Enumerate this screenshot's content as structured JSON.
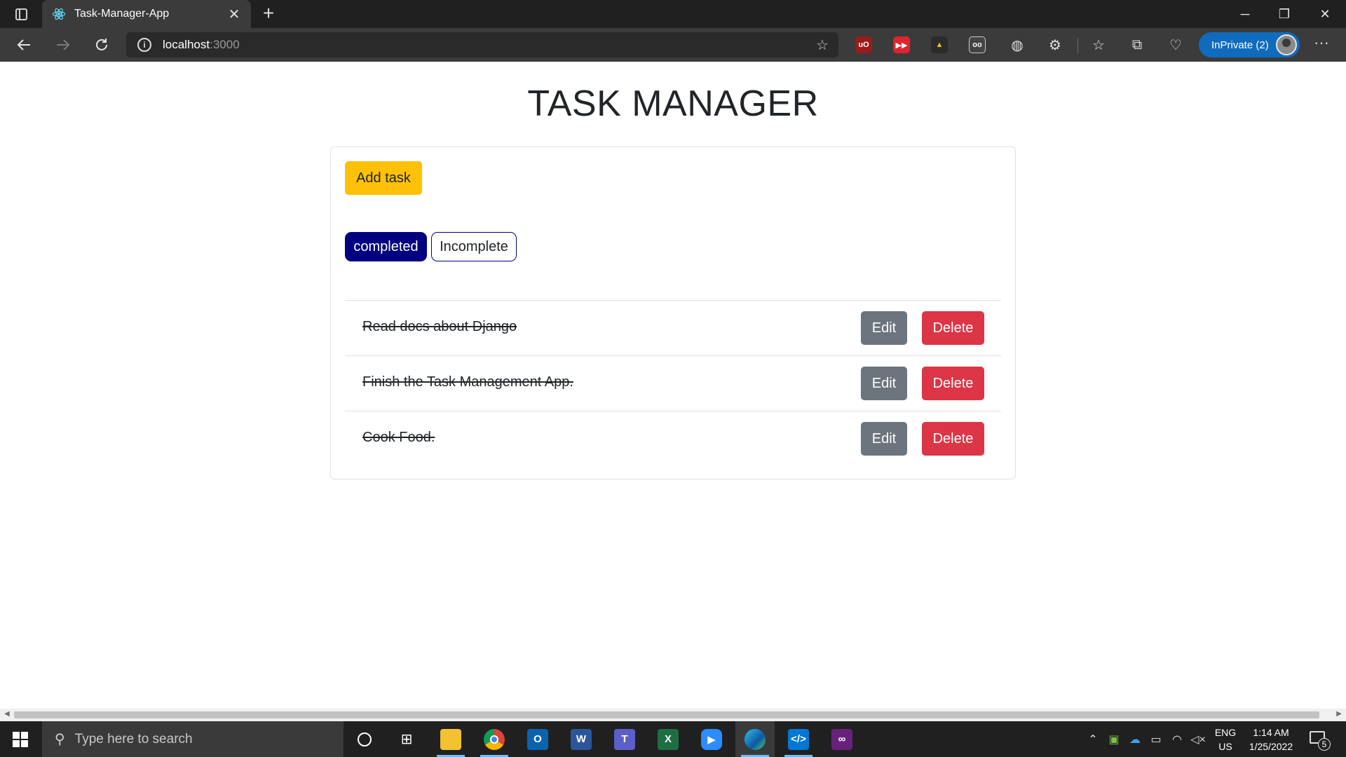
{
  "browser": {
    "tab_title": "Task-Manager-App",
    "tab_close": "✕",
    "new_tab": "+",
    "url_host": "localhost",
    "url_port": ":3000",
    "inprivate_label": "InPrivate (2)",
    "window_controls": {
      "minimize": "─",
      "restore": "❐",
      "close": "✕"
    }
  },
  "page": {
    "title": "TASK MANAGER",
    "add_task_label": "Add task",
    "filters": {
      "completed": "completed",
      "incomplete": "Incomplete"
    },
    "filter_active": "completed",
    "tasks": [
      {
        "text": "Read docs about Django",
        "completed": true,
        "edit_label": "Edit",
        "delete_label": "Delete"
      },
      {
        "text": "Finish the Task Management App.",
        "completed": true,
        "edit_label": "Edit",
        "delete_label": "Delete"
      },
      {
        "text": "Cook Food.",
        "completed": true,
        "edit_label": "Edit",
        "delete_label": "Delete"
      }
    ]
  },
  "taskbar": {
    "search_placeholder": "Type here to search",
    "lang_line1": "ENG",
    "lang_line2": "US",
    "time": "1:14 AM",
    "date": "1/25/2022",
    "notification_count": "5",
    "apps": [
      "cortana-icon",
      "task-view-icon",
      "file-explorer-icon",
      "chrome-icon",
      "outlook-icon",
      "word-icon",
      "teams-icon",
      "excel-icon",
      "zoom-icon",
      "edge-icon",
      "vscode-icon",
      "visual-studio-icon"
    ]
  },
  "colors": {
    "add_task": "#ffc107",
    "completed_filter": "#000080",
    "edit": "#6c757d",
    "delete": "#dc3545",
    "inprivate": "#0f6cbd"
  }
}
